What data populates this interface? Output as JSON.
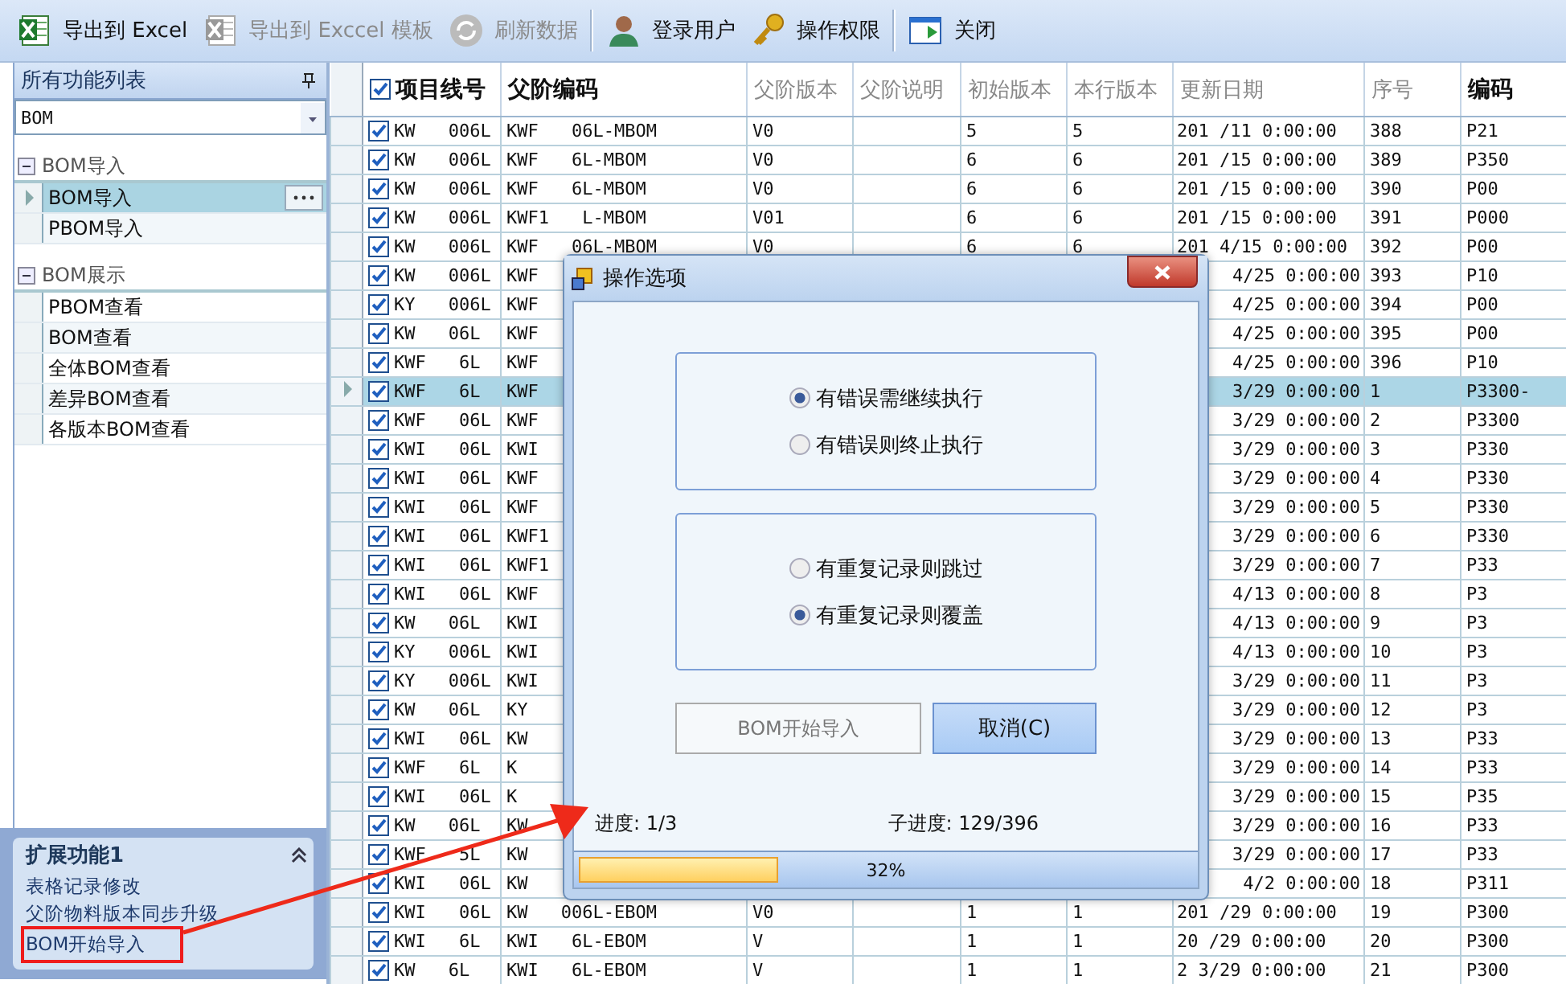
{
  "toolbar": [
    {
      "label": "导出到 Excel",
      "disabled": false,
      "separator_after": false
    },
    {
      "label": "导出到 Exccel 模板",
      "disabled": true,
      "separator_after": false
    },
    {
      "label": "刷新数据",
      "disabled": true,
      "separator_after": true
    },
    {
      "label": "登录用户",
      "disabled": false,
      "separator_after": false
    },
    {
      "label": "操作权限",
      "disabled": false,
      "separator_after": true
    },
    {
      "label": "关闭",
      "disabled": false,
      "separator_after": false
    }
  ],
  "sidebar": {
    "title": "所有功能列表",
    "filter": "BOM",
    "groups": [
      {
        "label": "BOM导入",
        "expanded": true,
        "items": [
          {
            "label": "BOM导入",
            "selected": true
          },
          {
            "label": "PBOM导入",
            "selected": false
          }
        ]
      },
      {
        "label": "BOM展示",
        "expanded": true,
        "items": [
          {
            "label": "PBOM查看",
            "selected": false
          },
          {
            "label": "BOM查看",
            "selected": false
          },
          {
            "label": "全体BOM查看",
            "selected": false
          },
          {
            "label": "差异BOM查看",
            "selected": false
          },
          {
            "label": "各版本BOM查看",
            "selected": false
          }
        ]
      }
    ],
    "extension": {
      "title": "扩展功能1",
      "expanded": true,
      "items": [
        {
          "label": "表格记录修改",
          "highlighted": false
        },
        {
          "label": "父阶物料版本同步升级",
          "highlighted": false
        },
        {
          "label": "BOM开始导入",
          "highlighted": true
        }
      ]
    }
  },
  "table": {
    "header_checked": true,
    "columns": [
      {
        "label": "项目线号",
        "emphasis": true
      },
      {
        "label": "父阶编码",
        "emphasis": true
      },
      {
        "label": "父阶版本",
        "emphasis": false
      },
      {
        "label": "父阶说明",
        "emphasis": false
      },
      {
        "label": "初始版本",
        "emphasis": false
      },
      {
        "label": "本行版本",
        "emphasis": false
      },
      {
        "label": "更新日期",
        "emphasis": false
      },
      {
        "label": "序号",
        "emphasis": false
      },
      {
        "label": "编码",
        "emphasis": true
      }
    ],
    "rows": [
      {
        "kind": "full",
        "checked": true,
        "selected": false,
        "cells": [
          "KW 006L",
          "KWF 06L-MBOM",
          "V0",
          "",
          "5",
          "5",
          "201 /11 0:00:00",
          "388",
          "P21"
        ]
      },
      {
        "kind": "full",
        "checked": true,
        "selected": false,
        "cells": [
          "KW 006L",
          "KWF 6L-MBOM",
          "V0",
          "",
          "6",
          "6",
          "201 /15 0:00:00",
          "389",
          "P350"
        ]
      },
      {
        "kind": "full",
        "checked": true,
        "selected": false,
        "cells": [
          "KW 006L",
          "KWF 6L-MBOM",
          "V0",
          "",
          "6",
          "6",
          "201 /15 0:00:00",
          "390",
          "P00"
        ]
      },
      {
        "kind": "full",
        "checked": true,
        "selected": false,
        "cells": [
          "KW 006L",
          "KWF1 L-MBOM",
          "V01",
          "",
          "6",
          "6",
          "201 /15 0:00:00",
          "391",
          "P000"
        ]
      },
      {
        "kind": "full",
        "checked": true,
        "selected": false,
        "cells": [
          "KW 006L",
          "KWF 06L-MBOM",
          "V0",
          "",
          "6",
          "6",
          "201 4/15 0:00:00",
          "392",
          "P00"
        ]
      },
      {
        "kind": "covered",
        "checked": true,
        "selected": false,
        "cells": [
          "KW 006L",
          "KWF",
          "4/25 0:00:00",
          "393",
          "P10"
        ]
      },
      {
        "kind": "covered",
        "checked": true,
        "selected": false,
        "cells": [
          "KY 006L",
          "KWF",
          "4/25 0:00:00",
          "394",
          "P00"
        ]
      },
      {
        "kind": "covered",
        "checked": true,
        "selected": false,
        "cells": [
          "KW 06L",
          "KWF",
          "4/25 0:00:00",
          "395",
          "P00"
        ]
      },
      {
        "kind": "covered",
        "checked": true,
        "selected": false,
        "cells": [
          "KWF 6L",
          "KWF",
          "4/25 0:00:00",
          "396",
          "P10"
        ]
      },
      {
        "kind": "covered",
        "checked": true,
        "selected": true,
        "cells": [
          "KWF 6L",
          "KWF",
          "3/29 0:00:00",
          "1",
          "P3300-"
        ]
      },
      {
        "kind": "covered",
        "checked": true,
        "selected": false,
        "cells": [
          "KWF 06L",
          "KWF",
          "3/29 0:00:00",
          "2",
          "P3300"
        ]
      },
      {
        "kind": "covered",
        "checked": true,
        "selected": false,
        "cells": [
          "KWI 06L",
          "KWI",
          "3/29 0:00:00",
          "3",
          "P330"
        ]
      },
      {
        "kind": "covered",
        "checked": true,
        "selected": false,
        "cells": [
          "KWI 06L",
          "KWF",
          "3/29 0:00:00",
          "4",
          "P330"
        ]
      },
      {
        "kind": "covered",
        "checked": true,
        "selected": false,
        "cells": [
          "KWI 06L",
          "KWF",
          "3/29 0:00:00",
          "5",
          "P330"
        ]
      },
      {
        "kind": "covered",
        "checked": true,
        "selected": false,
        "cells": [
          "KWI 06L",
          "KWF1",
          "3/29 0:00:00",
          "6",
          "P330"
        ]
      },
      {
        "kind": "covered",
        "checked": true,
        "selected": false,
        "cells": [
          "KWI 06L",
          "KWF1",
          "3/29 0:00:00",
          "7",
          "P33"
        ]
      },
      {
        "kind": "covered",
        "checked": true,
        "selected": false,
        "cells": [
          "KWI 06L",
          "KWF",
          "4/13 0:00:00",
          "8",
          "P3"
        ]
      },
      {
        "kind": "covered",
        "checked": true,
        "selected": false,
        "cells": [
          "KW 06L",
          "KWI",
          "4/13 0:00:00",
          "9",
          "P3"
        ]
      },
      {
        "kind": "covered",
        "checked": true,
        "selected": false,
        "cells": [
          "KY 006L",
          "KWI",
          "4/13 0:00:00",
          "10",
          "P3"
        ]
      },
      {
        "kind": "covered",
        "checked": true,
        "selected": false,
        "cells": [
          "KY 006L",
          "KWI",
          "3/29 0:00:00",
          "11",
          "P3"
        ]
      },
      {
        "kind": "covered",
        "checked": true,
        "selected": false,
        "cells": [
          "KW 06L",
          "KY",
          "3/29 0:00:00",
          "12",
          "P3"
        ]
      },
      {
        "kind": "covered",
        "checked": true,
        "selected": false,
        "cells": [
          "KWI 06L",
          "KW",
          "3/29 0:00:00",
          "13",
          "P33"
        ]
      },
      {
        "kind": "covered",
        "checked": true,
        "selected": false,
        "cells": [
          "KWF 6L",
          "K",
          "3/29 0:00:00",
          "14",
          "P33"
        ]
      },
      {
        "kind": "covered",
        "checked": true,
        "selected": false,
        "cells": [
          "KWI 06L",
          "K",
          "3/29 0:00:00",
          "15",
          "P35"
        ]
      },
      {
        "kind": "covered",
        "checked": true,
        "selected": false,
        "cells": [
          "KW 06L",
          "KW",
          "3/29 0:00:00",
          "16",
          "P33"
        ]
      },
      {
        "kind": "covered",
        "checked": true,
        "selected": false,
        "cells": [
          "KWF 5L",
          "KW",
          "3/29 0:00:00",
          "17",
          "P33"
        ]
      },
      {
        "kind": "covered",
        "checked": true,
        "selected": false,
        "cells": [
          "KWI 06L",
          "KW",
          "4/2 0:00:00",
          "18",
          "P311"
        ]
      },
      {
        "kind": "full",
        "checked": true,
        "selected": false,
        "cells": [
          "KWI 06L",
          "KW 006L-EBOM",
          "V0",
          "",
          "1",
          "1",
          "201 /29 0:00:00",
          "19",
          "P300"
        ]
      },
      {
        "kind": "full",
        "checked": true,
        "selected": false,
        "cells": [
          "KWI 6L",
          "KWI 6L-EBOM",
          "V",
          "",
          "1",
          "1",
          "20 /29 0:00:00",
          "20",
          "P300"
        ]
      },
      {
        "kind": "full",
        "checked": true,
        "selected": false,
        "cells": [
          "KW 6L",
          "KWI 6L-EBOM",
          "V",
          "",
          "1",
          "1",
          "2 3/29 0:00:00",
          "21",
          "P300"
        ]
      }
    ]
  },
  "dialog": {
    "title": "操作选项",
    "option_groups": [
      {
        "options": [
          {
            "label": "有错误需继续执行",
            "selected": true
          },
          {
            "label": "有错误则终止执行",
            "selected": false
          }
        ]
      },
      {
        "options": [
          {
            "label": "有重复记录则跳过",
            "selected": false
          },
          {
            "label": "有重复记录则覆盖",
            "selected": true
          }
        ]
      }
    ],
    "buttons": [
      {
        "label": "BOM开始导入",
        "disabled": true,
        "focused": false
      },
      {
        "label": "取消(C)",
        "disabled": false,
        "focused": true
      }
    ],
    "progress_label": "进度: 1/3",
    "sub_progress_label": "子进度: 129/396",
    "progress": {
      "level": 0.32,
      "reading": "32%"
    }
  }
}
